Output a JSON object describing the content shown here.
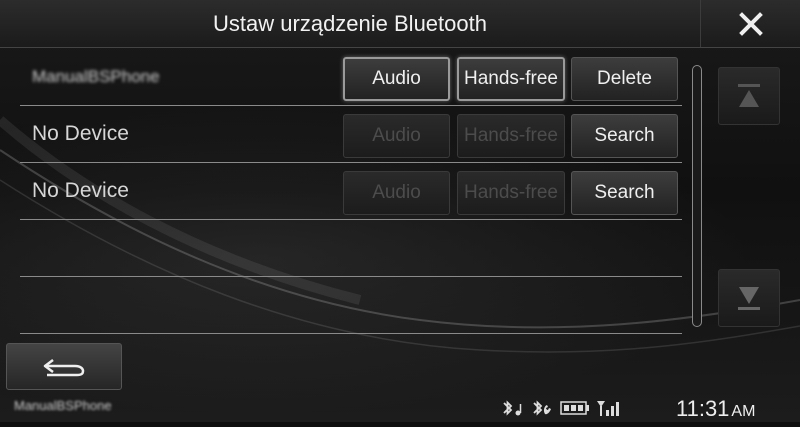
{
  "window": {
    "title": "Ustaw urządzenie Bluetooth"
  },
  "devices": [
    {
      "name": "ManualBSPhone",
      "buttons": [
        "Audio",
        "Hands-free",
        "Delete"
      ]
    },
    {
      "name": "No Device",
      "buttons": [
        "Audio",
        "Hands-free",
        "Search"
      ]
    },
    {
      "name": "No Device",
      "buttons": [
        "Audio",
        "Hands-free",
        "Search"
      ]
    }
  ],
  "status": {
    "device_name": "ManualBSPhone",
    "time": "11:31",
    "ampm": "AM"
  },
  "icons": {
    "close": "close-icon",
    "back": "back-arrow-icon",
    "scroll_up": "scroll-top-icon",
    "scroll_down": "scroll-bottom-icon",
    "bt_audio": "bluetooth-audio-icon",
    "bt_phone": "bluetooth-phone-icon",
    "battery": "battery-icon",
    "signal": "signal-icon"
  }
}
